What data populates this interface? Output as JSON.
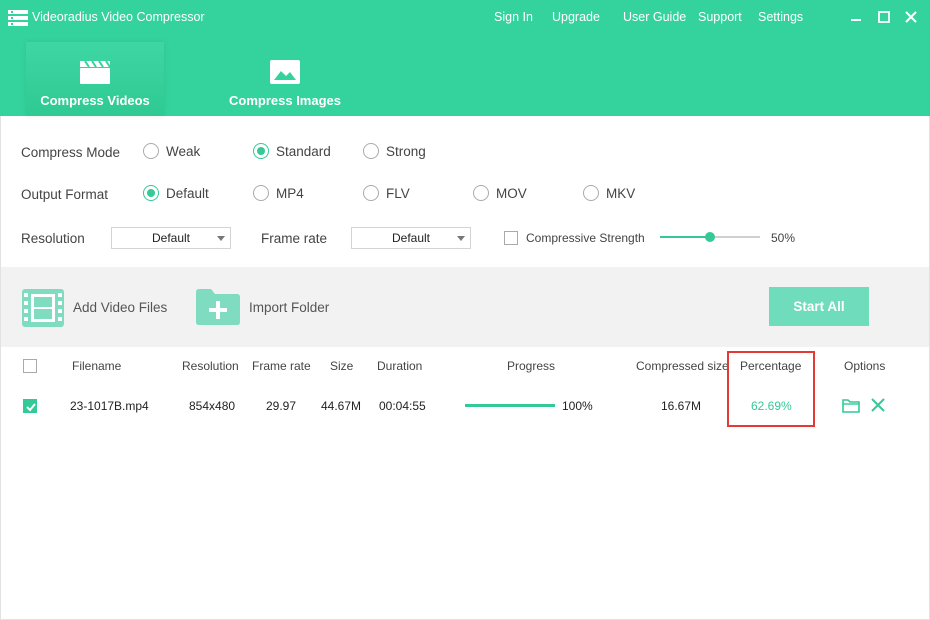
{
  "app": {
    "title": "Videoradius Video Compressor",
    "nav": [
      "Sign In",
      "Upgrade",
      "User Guide",
      "Support",
      "Settings"
    ],
    "accent_color": "#34d39d"
  },
  "tabs": [
    {
      "label": "Compress Videos",
      "icon": "clapperboard-icon",
      "active": true
    },
    {
      "label": "Compress Images",
      "icon": "image-icon",
      "active": false
    }
  ],
  "compress_mode": {
    "label": "Compress Mode",
    "options": [
      "Weak",
      "Standard",
      "Strong"
    ],
    "selected": "Standard"
  },
  "output_format": {
    "label": "Output Format",
    "options": [
      "Default",
      "MP4",
      "FLV",
      "MOV",
      "MKV"
    ],
    "selected": "Default"
  },
  "resolution": {
    "label": "Resolution",
    "value": "Default"
  },
  "frame_rate": {
    "label": "Frame rate",
    "value": "Default"
  },
  "compressive_strength": {
    "label": "Compressive Strength",
    "checked": false,
    "value_text": "50%",
    "value": 0.5
  },
  "toolbar": {
    "add_files": "Add Video Files",
    "import_folder": "Import Folder",
    "start_all": "Start All"
  },
  "table": {
    "headers": [
      "Filename",
      "Resolution",
      "Frame rate",
      "Size",
      "Duration",
      "Progress",
      "Compressed size",
      "Percentage",
      "Options"
    ],
    "rows": [
      {
        "checked": true,
        "filename": "23-1017B.mp4",
        "resolution": "854x480",
        "frame_rate": "29.97",
        "size": "44.67M",
        "duration": "00:04:55",
        "progress": 1.0,
        "progress_text": "100%",
        "compressed_size": "16.67M",
        "percentage": "62.69%"
      }
    ]
  }
}
